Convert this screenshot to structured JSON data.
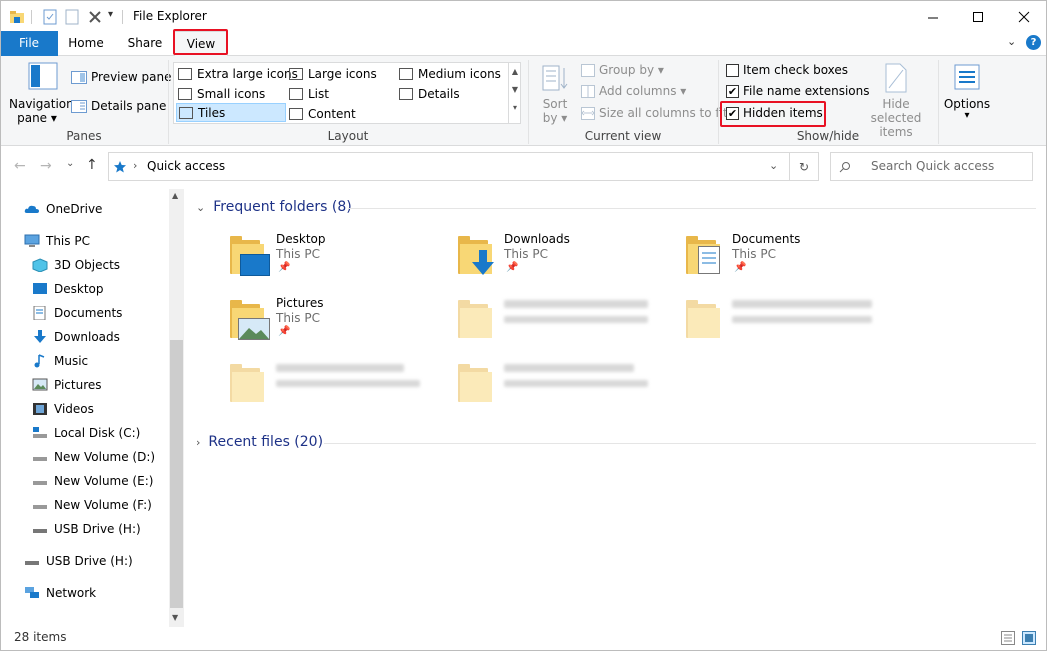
{
  "window": {
    "title": "File Explorer"
  },
  "tabs": [
    "File",
    "Home",
    "Share",
    "View"
  ],
  "ribbon": {
    "panes": {
      "label": "Panes",
      "navigation_pane_1": "Navigation",
      "navigation_pane_2": "pane ▾",
      "preview_pane": "Preview pane",
      "details_pane": "Details pane"
    },
    "layout": {
      "label": "Layout",
      "extra_large_icons": "Extra large icons",
      "large_icons": "Large icons",
      "medium_icons": "Medium icons",
      "small_icons": "Small icons",
      "list": "List",
      "details": "Details",
      "tiles": "Tiles",
      "content": "Content"
    },
    "current_view": {
      "label": "Current view",
      "sort_by_1": "Sort",
      "sort_by_2": "by ▾",
      "group_by": "Group by ▾",
      "add_columns": "Add columns ▾",
      "size_all_columns": "Size all columns to fit"
    },
    "show_hide": {
      "label": "Show/hide",
      "item_check_boxes": "Item check boxes",
      "item_check_boxes_checked": false,
      "file_name_extensions": "File name extensions",
      "file_name_extensions_checked": true,
      "hidden_items": "Hidden items",
      "hidden_items_checked": true,
      "hide_selected_1": "Hide selected",
      "hide_selected_2": "items"
    },
    "options": {
      "label": "Options",
      "arrow": "▾"
    }
  },
  "address": {
    "path": "Quick access",
    "search_placeholder": "Search Quick access"
  },
  "nav": {
    "onedrive": "OneDrive",
    "this_pc": "This PC",
    "objects3d": "3D Objects",
    "desktop": "Desktop",
    "documents": "Documents",
    "downloads": "Downloads",
    "music": "Music",
    "pictures": "Pictures",
    "videos": "Videos",
    "local_disk": "Local Disk (C:)",
    "vol_d": "New Volume (D:)",
    "vol_e": "New Volume (E:)",
    "vol_f": "New Volume (F:)",
    "usb_h_sub": "USB Drive (H:)",
    "usb_h": "USB Drive (H:)",
    "network": "Network"
  },
  "content": {
    "frequent_header": "Frequent folders (8)",
    "recent_header": "Recent files (20)",
    "folders": [
      {
        "name": "Desktop",
        "location": "This PC"
      },
      {
        "name": "Downloads",
        "location": "This PC"
      },
      {
        "name": "Documents",
        "location": "This PC"
      },
      {
        "name": "Pictures",
        "location": "This PC"
      }
    ]
  },
  "status": {
    "item_count": "28 items"
  },
  "colors": {
    "accent": "#1979ca",
    "highlight": "#e81123",
    "section_header": "#1e3287"
  }
}
